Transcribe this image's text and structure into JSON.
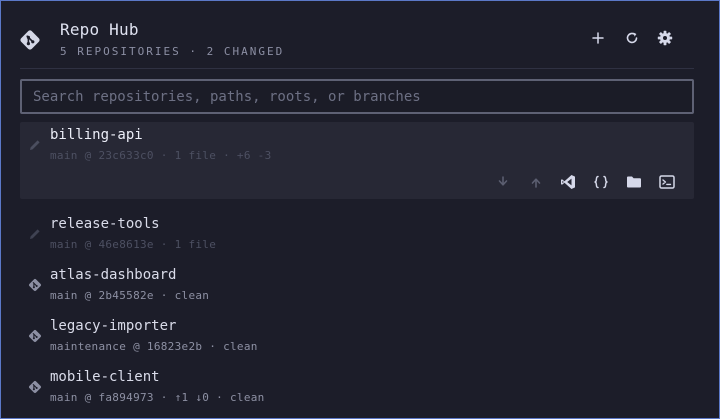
{
  "header": {
    "title": "Repo Hub",
    "subtitle": "5 REPOSITORIES · 2 CHANGED",
    "icons": [
      "git-logo-icon",
      "plus-icon",
      "refresh-icon",
      "gear-icon"
    ]
  },
  "search": {
    "placeholder": "Search repositories, paths, roots, or branches",
    "value": ""
  },
  "repositories": [
    {
      "name": "billing-api",
      "meta": "main @ 23c633c0 · 1 file · +6 -3",
      "icon": "pencil-icon",
      "selected": true
    },
    {
      "name": "release-tools",
      "meta": "main @ 46e8613e · 1 file",
      "icon": "pencil-icon",
      "selected": false
    },
    {
      "name": "atlas-dashboard",
      "meta": "main @ 2b45582e · clean",
      "icon": "git-icon",
      "selected": false
    },
    {
      "name": "legacy-importer",
      "meta": "maintenance @ 16823e2b · clean",
      "icon": "git-icon",
      "selected": false
    },
    {
      "name": "mobile-client",
      "meta": "main @ fa894973 · ↑1 ↓0 · clean",
      "icon": "git-icon",
      "selected": false
    }
  ],
  "row_actions": [
    "pull-icon",
    "push-icon",
    "vscode-icon",
    "json-icon",
    "folder-icon",
    "terminal-icon"
  ],
  "colors": {
    "background": "#1c1d29",
    "selected_row": "#272835",
    "accent_border": "#5b78c7",
    "action_active": "#d6d9ea",
    "action_muted": "#5b5e70"
  }
}
